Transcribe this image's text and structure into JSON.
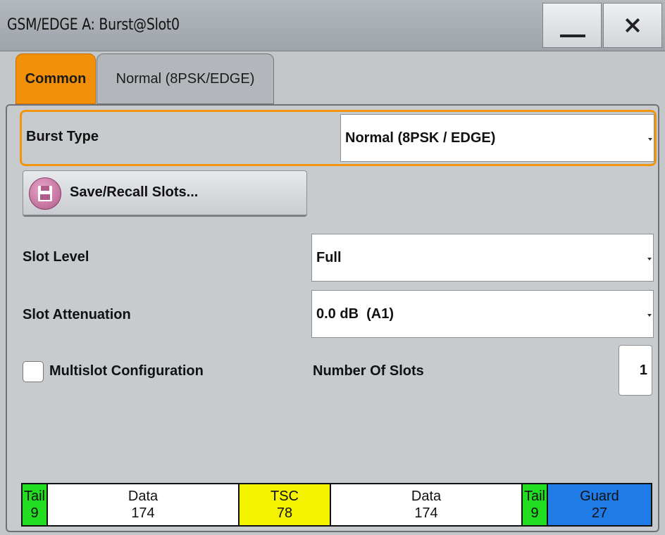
{
  "window": {
    "title": "GSM/EDGE A: Burst@Slot0"
  },
  "tabs": [
    {
      "label": "Common",
      "active": true
    },
    {
      "label": "Normal (8PSK/EDGE)",
      "active": false
    }
  ],
  "burst_type": {
    "label": "Burst Type",
    "value": "Normal (8PSK / EDGE)"
  },
  "save_recall": {
    "label": "Save/Recall Slots...",
    "icon": "floppy-disk-icon"
  },
  "slot_level": {
    "label": "Slot Level",
    "value": "Full"
  },
  "slot_attenuation": {
    "label": "Slot Attenuation",
    "value": "0.0 dB  (A1)"
  },
  "multislot": {
    "label": "Multislot Configuration",
    "checked": false
  },
  "number_of_slots": {
    "label": "Number Of Slots",
    "value": "1"
  },
  "burst_structure": [
    {
      "name": "Tail",
      "bits": "9",
      "color": "#22dd22"
    },
    {
      "name": "Data",
      "bits": "174",
      "color": "#ffffff"
    },
    {
      "name": "TSC",
      "bits": "78",
      "color": "#f4f400"
    },
    {
      "name": "Data",
      "bits": "174",
      "color": "#ffffff"
    },
    {
      "name": "Tail",
      "bits": "9",
      "color": "#22dd22"
    },
    {
      "name": "Guard",
      "bits": "27",
      "color": "#1f7be6"
    }
  ],
  "colors": {
    "accent": "#f2900a",
    "panel": "#c8cbce"
  }
}
